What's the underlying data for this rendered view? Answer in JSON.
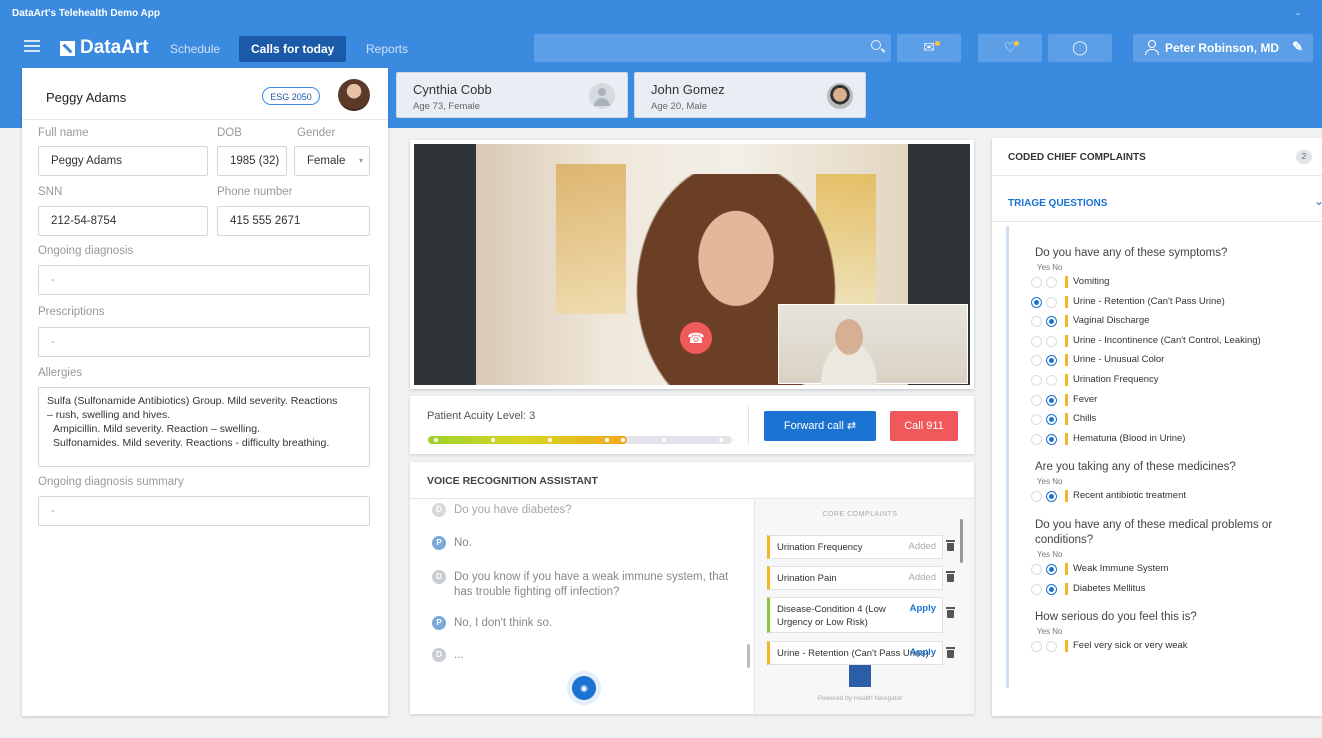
{
  "app": {
    "title": "DataArt's Telehealth Demo App",
    "window_min": "-"
  },
  "nav": {
    "logo": "DataArt",
    "items": [
      {
        "label": "Schedule"
      },
      {
        "label": "Calls for today"
      },
      {
        "label": "Reports"
      }
    ]
  },
  "user": {
    "name": "Peter Robinson, MD"
  },
  "icons": {
    "menu": "hamburger-icon",
    "search": "search-icon",
    "mail": "mail-icon",
    "bell": "bell-icon",
    "support": "support-icon",
    "user": "user-icon",
    "edit": "pencil-icon",
    "hangup": "phone-hangup-icon",
    "forward": "forward-icon",
    "mic": "microphone-icon"
  },
  "colors": {
    "brand": "#3a8be0",
    "accent": "#1a73d1",
    "danger": "#f0585b",
    "warning": "#f1b62a"
  },
  "patient": {
    "name": "Peggy Adams",
    "badge": "ESG 2050",
    "labels": {
      "full_name": "Full name",
      "dob": "DOB",
      "gender": "Gender",
      "snn": "SNN",
      "phone": "Phone number",
      "ongoing": "Ongoing diagnosis",
      "prescriptions": "Prescriptions",
      "allergies": "Allergies",
      "summary": "Ongoing diagnosis summary"
    },
    "full_name": "Peggy Adams",
    "dob": "1985 (32)",
    "gender": "Female",
    "snn": "212-54-8754",
    "phone": "415 555 2671",
    "ongoing": "-",
    "prescriptions": "-",
    "allergies": [
      "Sulfa (Sulfonamide Antibiotics) Group. Mild severity. Reactions",
      "– rush, swelling and hives.",
      "Ampicillin. Mild severity. Reaction – swelling.",
      "Sulfonamides. Mild severity. Reactions - difficulty breathing."
    ],
    "summary": "-"
  },
  "queue": [
    {
      "name": "Cynthia Cobb",
      "info": "Age 73, Female"
    },
    {
      "name": "John Gomez",
      "info": "Age 20, Male"
    }
  ],
  "acuity": {
    "label": "Patient Acuity Level: 3",
    "level": 3,
    "max": 5,
    "fill_fraction": 0.64,
    "forward_label": "Forward call",
    "call_label": "Call 911"
  },
  "voice": {
    "title": "VOICE RECOGNITION ASSISTANT",
    "messages": [
      {
        "who": "D",
        "text": "Do you have diabetes?"
      },
      {
        "who": "P",
        "text": "No."
      },
      {
        "who": "D",
        "text": "Do you know if you have a weak immune system, that has trouble fighting off infection?"
      },
      {
        "who": "P",
        "text": "No, I don't think so."
      },
      {
        "who": "D",
        "text": "..."
      }
    ],
    "core_title": "CORE COMPLAINTS",
    "complaints": [
      {
        "text": "Urination Frequency",
        "status": "Added"
      },
      {
        "text": "Urination Pain",
        "status": "Added"
      },
      {
        "text": "Disease-Condition 4 (Low Urgency or Low Risk)",
        "status": "Apply"
      },
      {
        "text": "Urine - Retention (Can't Pass Urine)",
        "status": "Apply"
      }
    ],
    "powered": "Powered by Health Navigator"
  },
  "right": {
    "coded_title": "CODED CHIEF COMPLAINTS",
    "coded_count": "2",
    "triage_title": "TRIAGE QUESTIONS",
    "yes": "Yes",
    "no": "No",
    "questions": [
      {
        "text": "Do you have any of these symptoms?",
        "options": [
          {
            "label": "Vomiting",
            "answer": "none"
          },
          {
            "label": "Urine - Retention (Can't Pass Urine)",
            "answer": "yes"
          },
          {
            "label": "Vaginal Discharge",
            "answer": "no"
          },
          {
            "label": "Urine - Incontinence (Can't Control, Leaking)",
            "answer": "none"
          },
          {
            "label": "Urine - Unusual Color",
            "answer": "no"
          },
          {
            "label": "Urination Frequency",
            "answer": "none"
          },
          {
            "label": "Fever",
            "answer": "no"
          },
          {
            "label": "Chills",
            "answer": "no"
          },
          {
            "label": "Hematuria (Blood in Urine)",
            "answer": "no"
          }
        ]
      },
      {
        "text": "Are you taking any of these medicines?",
        "options": [
          {
            "label": "Recent antibiotic treatment",
            "answer": "no"
          }
        ]
      },
      {
        "text": "Do you have any of these medical problems or conditions?",
        "options": [
          {
            "label": "Weak Immune System",
            "answer": "no"
          },
          {
            "label": "Diabetes Mellitus",
            "answer": "no"
          }
        ]
      },
      {
        "text": "How serious do you feel this is?",
        "options": [
          {
            "label": "Feel very sick or very weak",
            "answer": "none"
          }
        ]
      }
    ]
  }
}
